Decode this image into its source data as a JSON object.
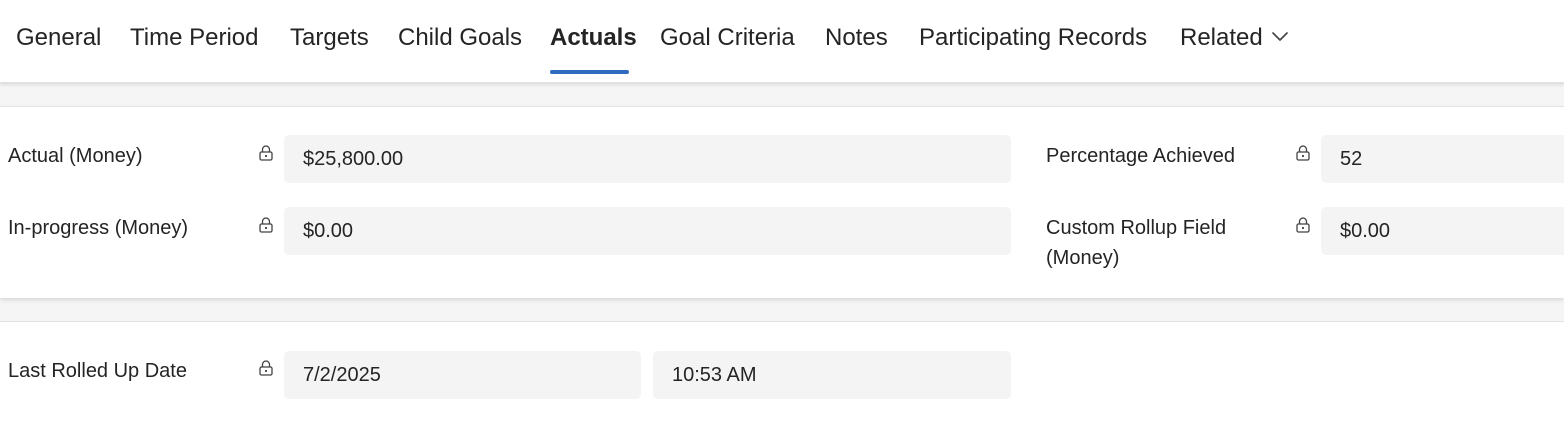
{
  "tabs": [
    {
      "label": "General",
      "active": false
    },
    {
      "label": "Time Period",
      "active": false
    },
    {
      "label": "Targets",
      "active": false
    },
    {
      "label": "Child Goals",
      "active": false
    },
    {
      "label": "Actuals",
      "active": true
    },
    {
      "label": "Goal Criteria",
      "active": false
    },
    {
      "label": "Notes",
      "active": false
    },
    {
      "label": "Participating Records",
      "active": false
    },
    {
      "label": "Related",
      "active": false,
      "icon": "chevron-down-icon"
    }
  ],
  "actuals_section": {
    "actual_money": {
      "label": "Actual (Money)",
      "value": "$25,800.00",
      "locked": true
    },
    "in_progress_money": {
      "label": "In-progress (Money)",
      "value": "$0.00",
      "locked": true
    },
    "percentage_achieved": {
      "label": "Percentage Achieved",
      "value": "52",
      "locked": true
    },
    "custom_rollup_money": {
      "label_line1": "Custom Rollup Field",
      "label_line2": "(Money)",
      "value": "$0.00",
      "locked": true
    }
  },
  "rollup_section": {
    "last_rolled_up_date": {
      "label": "Last Rolled Up Date",
      "date": "7/2/2025",
      "time": "10:53 AM",
      "locked": true
    }
  },
  "colors": {
    "accent": "#2f6cc0",
    "field_bg": "#f4f4f4",
    "page_bg": "#f5f5f5",
    "text": "#242424"
  },
  "icons": {
    "lock": "lock-icon",
    "related_dropdown": "chevron-down-icon"
  }
}
